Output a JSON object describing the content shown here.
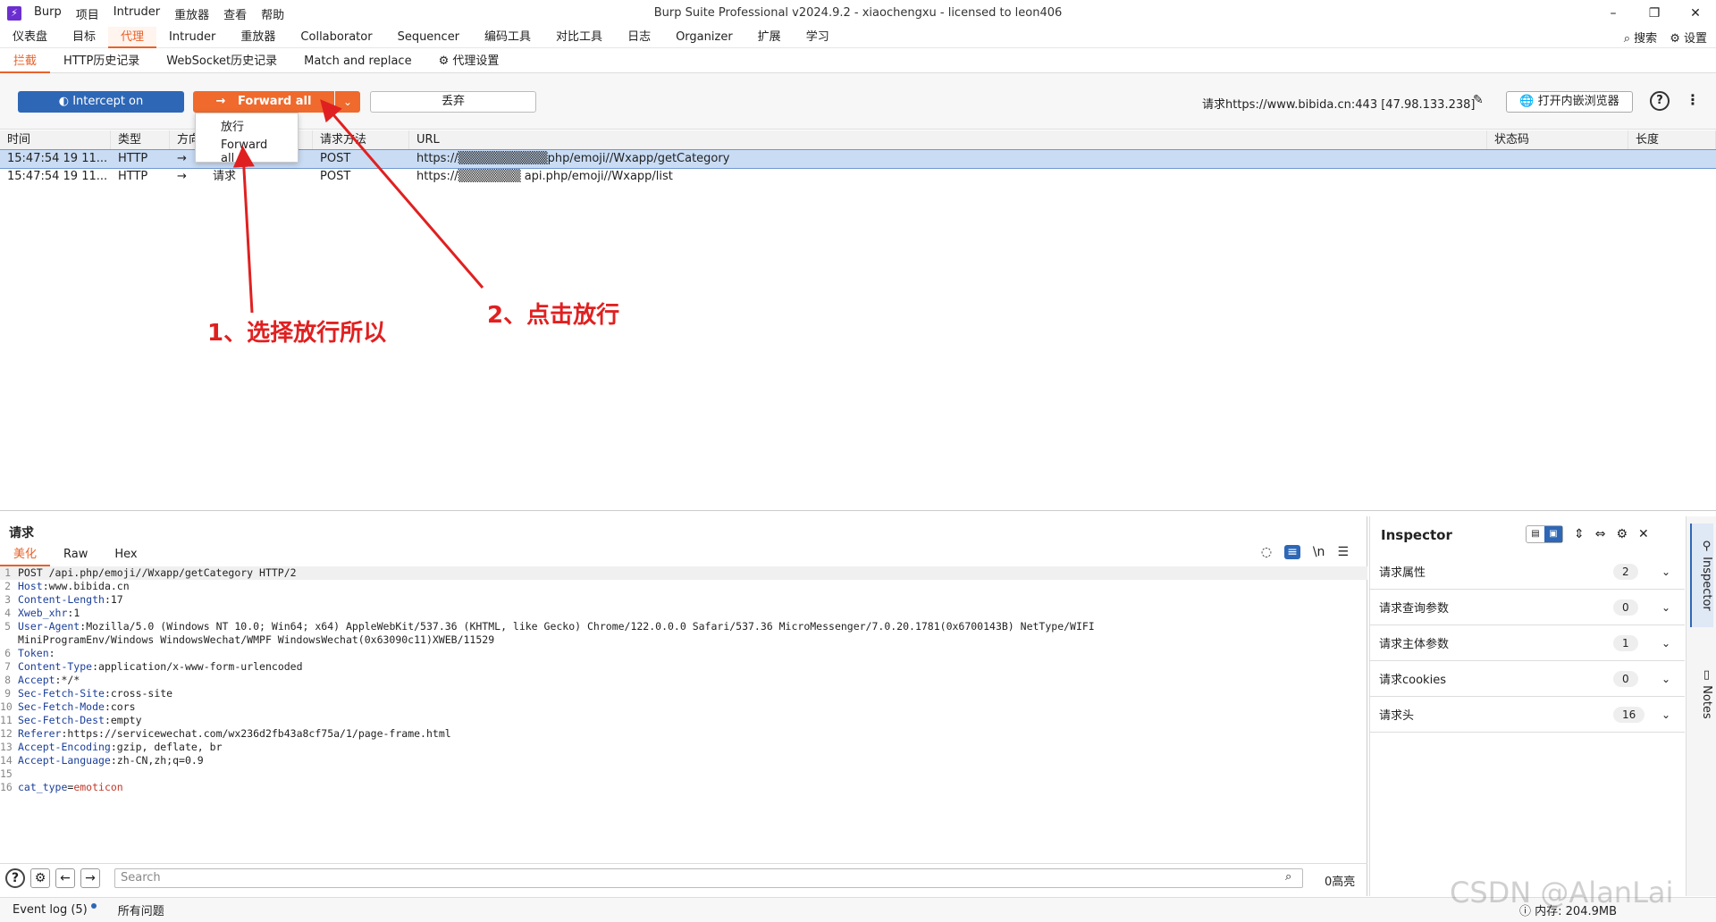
{
  "titlebar": {
    "app_menu": [
      "Burp",
      "项目",
      "Intruder",
      "重放器",
      "查看",
      "帮助"
    ],
    "title": "Burp Suite Professional v2024.9.2 - xiaochengxu - licensed to leon406",
    "minimize": "–",
    "maximize": "❐",
    "close": "✕"
  },
  "main_tabs": [
    "仪表盘",
    "目标",
    "代理",
    "Intruder",
    "重放器",
    "Collaborator",
    "Sequencer",
    "编码工具",
    "对比工具",
    "日志",
    "Organizer",
    "扩展",
    "学习"
  ],
  "main_tab_active_index": 2,
  "top_right": {
    "search": "搜索",
    "settings": "设置"
  },
  "sub_tabs": [
    "拦截",
    "HTTP历史记录",
    "WebSocket历史记录",
    "Match and replace",
    "代理设置"
  ],
  "sub_tab_active_index": 0,
  "toolbar": {
    "intercept_label": "Intercept on",
    "forward_label": "Forward all",
    "drop_label": "丢弃",
    "request_target": "请求https://www.bibida.cn:443  [47.98.133.238]",
    "browser_label": "打开内嵌浏览器"
  },
  "dropdown": {
    "items": [
      "放行",
      "Forward all"
    ]
  },
  "table": {
    "headers": [
      "时间",
      "类型",
      "方向",
      "",
      "请求方法",
      "URL",
      "状态码",
      "长度"
    ],
    "rows": [
      {
        "time": "15:47:54 19 11...",
        "type": "HTTP",
        "dir": "→",
        "dir_label": "请求",
        "method": "POST",
        "url": "https://▒▒▒▒▒▒▒▒▒▒php/emoji//Wxapp/getCategory"
      },
      {
        "time": "15:47:54 19 11...",
        "type": "HTTP",
        "dir": "→",
        "dir_label": "请求",
        "method": "POST",
        "url": "https://▒▒▒▒▒▒▒ api.php/emoji//Wxapp/list"
      }
    ]
  },
  "annotations": {
    "note1": "1、选择放行所以",
    "note2": "2、点击放行",
    "color": "#e02020"
  },
  "request_panel": {
    "title": "请求",
    "tabs": [
      "美化",
      "Raw",
      "Hex"
    ],
    "active_tab_index": 0,
    "lines": [
      {
        "n": "1",
        "key": "",
        "val": "POST /api.php/emoji//Wxapp/getCategory HTTP/2"
      },
      {
        "n": "2",
        "key": "Host",
        "val": " www.bibida.cn"
      },
      {
        "n": "3",
        "key": "Content-Length",
        "val": " 17"
      },
      {
        "n": "4",
        "key": "Xweb_xhr",
        "val": " 1"
      },
      {
        "n": "5",
        "key": "User-Agent",
        "val": " Mozilla/5.0 (Windows NT 10.0; Win64; x64) AppleWebKit/537.36 (KHTML, like Gecko) Chrome/122.0.0.0 Safari/537.36 MicroMessenger/7.0.20.1781(0x6700143B) NetType/WIFI"
      },
      {
        "n": "",
        "key": "",
        "val": "MiniProgramEnv/Windows WindowsWechat/WMPF WindowsWechat(0x63090c11)XWEB/11529"
      },
      {
        "n": "6",
        "key": "Token",
        "val": ""
      },
      {
        "n": "7",
        "key": "Content-Type",
        "val": " application/x-www-form-urlencoded"
      },
      {
        "n": "8",
        "key": "Accept",
        "val": " */*"
      },
      {
        "n": "9",
        "key": "Sec-Fetch-Site",
        "val": " cross-site"
      },
      {
        "n": "10",
        "key": "Sec-Fetch-Mode",
        "val": " cors"
      },
      {
        "n": "11",
        "key": "Sec-Fetch-Dest",
        "val": " empty"
      },
      {
        "n": "12",
        "key": "Referer",
        "val": " https://servicewechat.com/wx236d2fb43a8cf75a/1/page-frame.html"
      },
      {
        "n": "13",
        "key": "Accept-Encoding",
        "val": " gzip, deflate, br"
      },
      {
        "n": "14",
        "key": "Accept-Language",
        "val": " zh-CN,zh;q=0.9"
      },
      {
        "n": "15",
        "key": "",
        "val": ""
      }
    ],
    "body_line": {
      "n": "16",
      "param": "cat_type",
      "eq": "=",
      "value": "emoticon"
    },
    "search_placeholder": "Search",
    "highlight_count": "0高亮"
  },
  "inspector": {
    "title": "Inspector",
    "rows": [
      {
        "label": "请求属性",
        "count": "2"
      },
      {
        "label": "请求查询参数",
        "count": "0"
      },
      {
        "label": "请求主体参数",
        "count": "1"
      },
      {
        "label": "请求cookies",
        "count": "0"
      },
      {
        "label": "请求头",
        "count": "16"
      }
    ]
  },
  "side_rail": {
    "inspector": "Inspector",
    "notes": "Notes"
  },
  "statusbar": {
    "event_log": "Event log (5)",
    "issues": "所有问题",
    "memory": "内存: 204.9MB"
  },
  "watermark": "CSDN @AlanLai",
  "colors": {
    "accent": "#e8622a",
    "forward": "#ef6a2c",
    "intercept": "#2e67b6"
  }
}
